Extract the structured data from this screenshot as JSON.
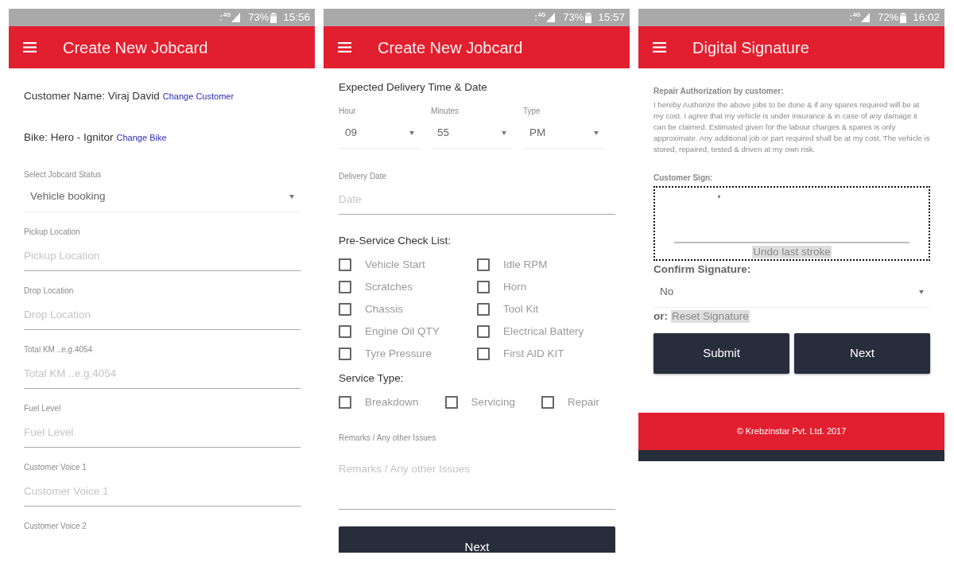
{
  "screens": [
    {
      "kind": "customer_form",
      "status_bar": {
        "network": "4G",
        "battery": "73%",
        "time": "15:56"
      },
      "app_bar": {
        "title": "Create New Jobcard"
      },
      "details": [
        {
          "text": "Customer Name: Viraj David",
          "link": "Change Customer"
        },
        {
          "text": "Bike: Hero - Ignitor",
          "link": "Change Bike"
        }
      ],
      "fields": [
        {
          "kind": "select",
          "label": "Select Jobcard Status",
          "value": "Vehicle booking"
        },
        {
          "kind": "input",
          "label": "Pickup Location",
          "placeholder": "Pickup Location"
        },
        {
          "kind": "input",
          "label": "Drop Location",
          "placeholder": "Drop Location"
        },
        {
          "kind": "input",
          "label": "Total KM ..e.g.4054",
          "placeholder": "Total KM ..e.g.4054"
        },
        {
          "kind": "input",
          "label": "Fuel Level",
          "placeholder": "Fuel Level"
        },
        {
          "kind": "input",
          "label": "Customer Voice 1",
          "placeholder": "Customer Voice 1"
        },
        {
          "kind": "input",
          "label": "Customer Voice 2"
        }
      ]
    },
    {
      "kind": "delivery_form",
      "status_bar": {
        "network": "4G",
        "battery": "73%",
        "time": "15:57"
      },
      "app_bar": {
        "title": "Create New Jobcard"
      },
      "delivery_heading": "Expected Delivery Time & Date",
      "time_selects": [
        {
          "label": "Hour",
          "value": "09"
        },
        {
          "label": "Minutes",
          "value": "55"
        },
        {
          "label": "Type",
          "value": "PM"
        }
      ],
      "date_field": {
        "label": "Delivery Date",
        "placeholder": "Date"
      },
      "checklist": {
        "title": "Pre-Service Check List:",
        "items": [
          {
            "label": "Vehicle Start",
            "checked": false
          },
          {
            "label": "Idle RPM",
            "checked": false
          },
          {
            "label": "Scratches",
            "checked": false
          },
          {
            "label": "Horn",
            "checked": false
          },
          {
            "label": "Chassis",
            "checked": false
          },
          {
            "label": "Tool Kit",
            "checked": false
          },
          {
            "label": "Engine Oil QTY",
            "checked": false
          },
          {
            "label": "Electrical Battery",
            "checked": false
          },
          {
            "label": "Tyre Pressure",
            "checked": false
          },
          {
            "label": "First AID KIT",
            "checked": false
          }
        ]
      },
      "service_type": {
        "title": "Service Type:",
        "items": [
          {
            "label": "Breakdown",
            "checked": false
          },
          {
            "label": "Servicing",
            "checked": false
          },
          {
            "label": "Repair",
            "checked": false
          }
        ]
      },
      "remarks": {
        "label": "Remarks / Any other Issues",
        "placeholder": "Remarks / Any other Issues"
      },
      "button": "Next"
    },
    {
      "kind": "signature_form",
      "status_bar": {
        "network": "4G",
        "battery": "72%",
        "time": "16:02"
      },
      "app_bar": {
        "title": "Digital Signature"
      },
      "authorization": {
        "title": "Repair Authorization by customer:",
        "text": "I hereby Authorize the above jobs to be done & if any spares required will be at my cost. I agree that my vehicle is under insurance & in case of any damage it can be claimed. Estimated given for the labour charges & spares is only approximate. Any additional job or part required shall be at my cost. The vehicle is stored, repaired, tested & driven at my own risk."
      },
      "sign_pad": {
        "label": "Customer Sign:",
        "undo": "Undo last stroke"
      },
      "confirm": {
        "label": "Confirm Signature:",
        "value": "No"
      },
      "reset": {
        "prefix": "or:",
        "button": "Reset Signature"
      },
      "buttons": [
        "Submit",
        "Next"
      ],
      "footer": "© Krebzinstar Pvt. Ltd. 2017"
    }
  ]
}
